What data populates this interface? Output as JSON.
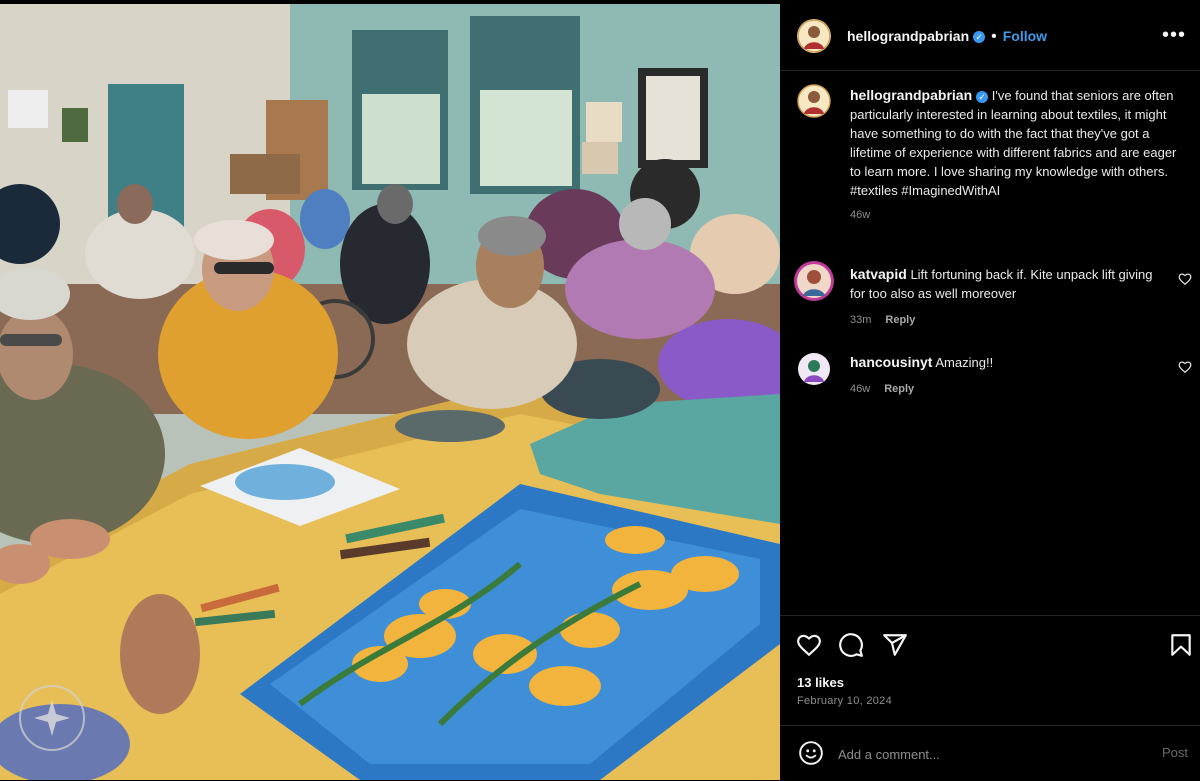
{
  "post": {
    "username": "hellograndpabrian",
    "verified_mark": "✓",
    "dot": "•",
    "follow_label": "Follow",
    "more_label": "•••",
    "caption": "I've found that seniors are often particularly interested in learning about textiles, it might have something to do with the fact that they've got a lifetime of experience with different fabrics and are eager to learn more. I love sharing my knowledge with others. #textiles #ImaginedWithAI",
    "caption_age": "46w"
  },
  "comments": [
    {
      "username": "katvapid",
      "text": "Lift fortuning back if. Kite unpack lift giving for too also as well moreover",
      "age": "33m",
      "reply_label": "Reply"
    },
    {
      "username": "hancousinyt",
      "text": "Amazing!!",
      "age": "46w",
      "reply_label": "Reply"
    }
  ],
  "actions": {
    "likes": "13 likes",
    "date": "February 10, 2024",
    "icons": [
      "heart-icon",
      "comment-icon",
      "share-icon",
      "bookmark-icon"
    ]
  },
  "add_comment": {
    "placeholder": "Add a comment...",
    "post_label": "Post"
  },
  "colors": {
    "link": "#3d9be9",
    "background": "#000000",
    "muted": "#8e8e8e"
  }
}
